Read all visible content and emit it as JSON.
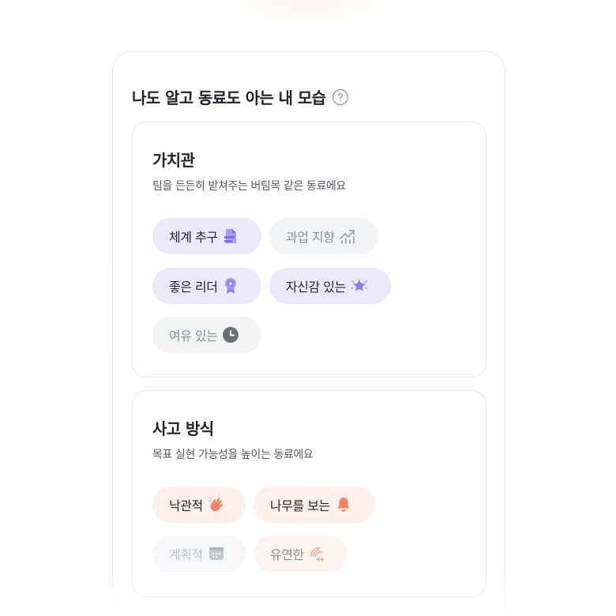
{
  "card": {
    "title": "나도 알고 동료도 아는 내 모습",
    "help_icon": "question-circle-icon"
  },
  "sections": [
    {
      "title": "가치관",
      "subtitle": "팀을 든든히 받쳐주는 버팀목 같은 동료에요",
      "chips": [
        {
          "label": "체계 추구",
          "icon": "document-icon",
          "state": "selected",
          "color": "#8b7cf6"
        },
        {
          "label": "과업 지향",
          "icon": "chart-trend-icon",
          "state": "unselected",
          "color": "#9ca1aa"
        },
        {
          "label": "좋은 리더",
          "icon": "award-badge-icon",
          "state": "selected",
          "color": "#8b7cf6"
        },
        {
          "label": "자신감 있는",
          "icon": "star-burst-icon",
          "state": "selected",
          "color": "#8b7cf6"
        },
        {
          "label": "여유 있는",
          "icon": "clock-icon",
          "state": "unselected",
          "color": "#6b6f77"
        }
      ]
    },
    {
      "title": "사고 방식",
      "subtitle": "목표 실현 가능성을 높이는 동료에요",
      "chips": [
        {
          "label": "낙관적",
          "icon": "waving-hand-icon",
          "state": "selected",
          "color": "#f28463"
        },
        {
          "label": "나무를 보는",
          "icon": "bell-icon",
          "state": "selected",
          "color": "#f28463"
        },
        {
          "label": "계획적",
          "icon": "calendar-icon",
          "state": "faded",
          "color": "#c5c8cd"
        },
        {
          "label": "유연한",
          "icon": "flex-arrows-icon",
          "state": "faded",
          "color": "#f5a98f"
        }
      ]
    }
  ],
  "colors": {
    "accent_purple": "#8b7cf6",
    "chip_purple_bg": "#ece9fd",
    "accent_orange": "#f28463",
    "chip_orange_bg": "#ffefe9",
    "chip_gray_bg": "#f3f4f6"
  }
}
